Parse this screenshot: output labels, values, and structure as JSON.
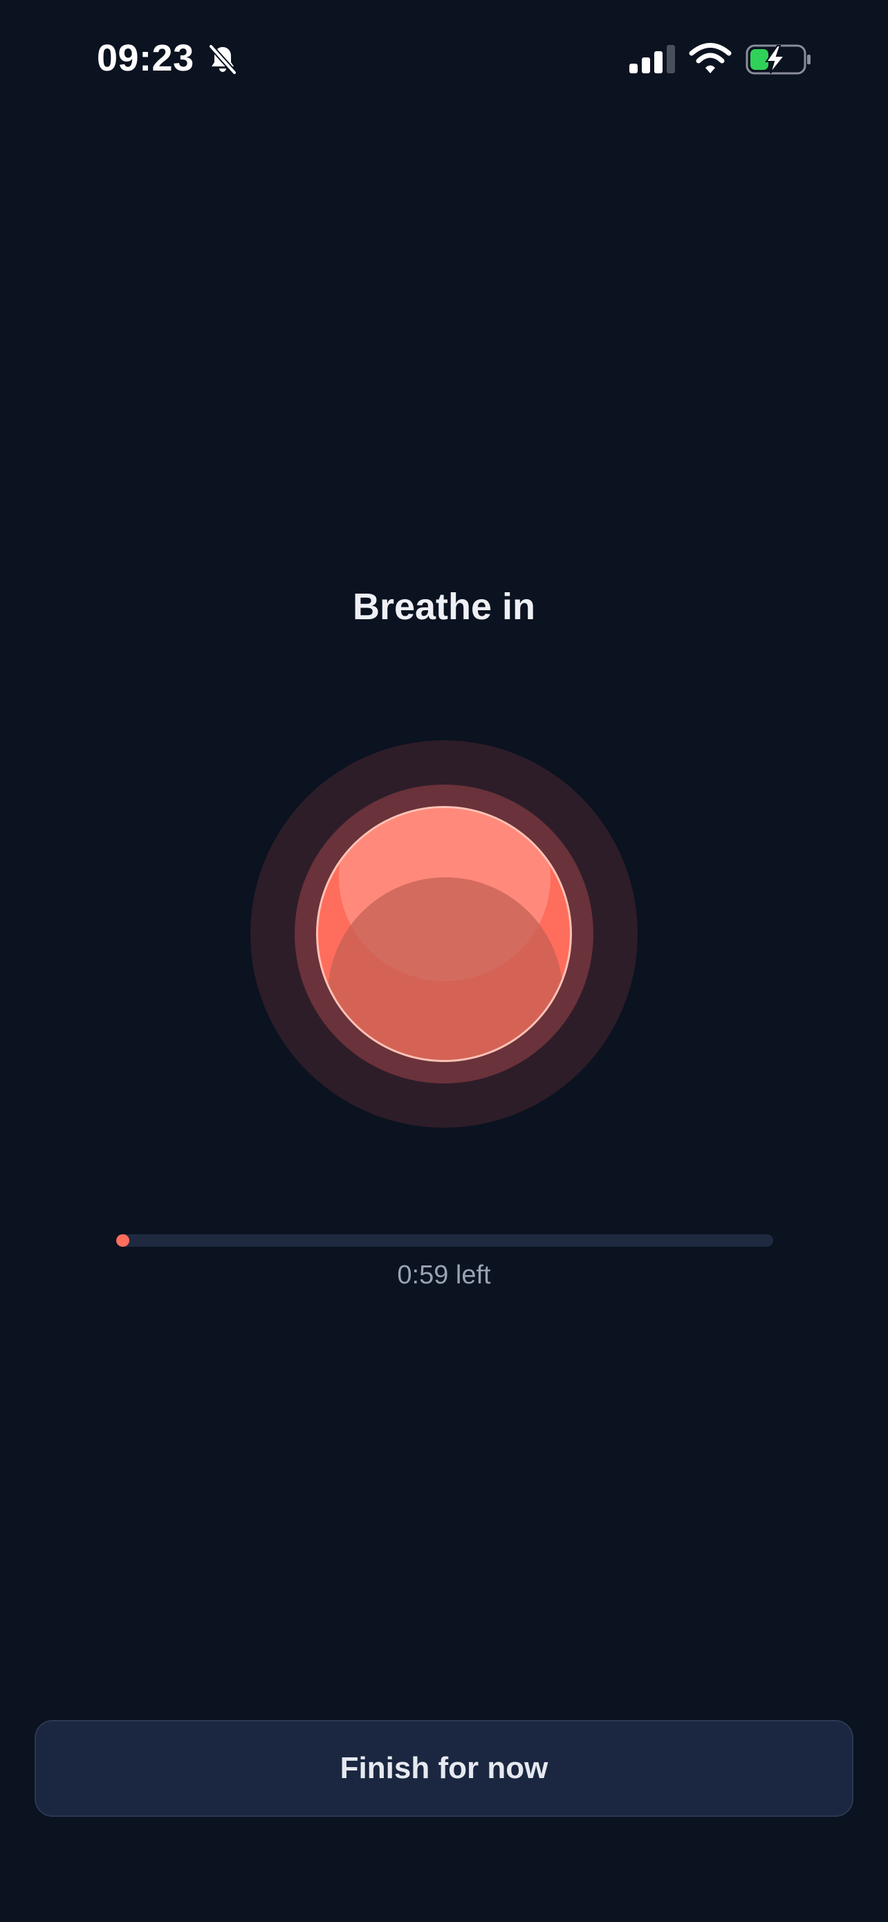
{
  "status_bar": {
    "time": "09:23",
    "icons": [
      "bell-slash-icon",
      "cellular-signal-icon",
      "wifi-icon",
      "battery-charging-icon"
    ],
    "battery_color": "#30d158"
  },
  "session": {
    "phase": "Breathe in",
    "progress_fraction": 0.02,
    "time_left": "0:59 left"
  },
  "actions": {
    "finish_label": "Finish for now"
  },
  "colors": {
    "background": "#0b1220",
    "accent": "#ff6d5c",
    "button_bg": "#1b2740"
  }
}
